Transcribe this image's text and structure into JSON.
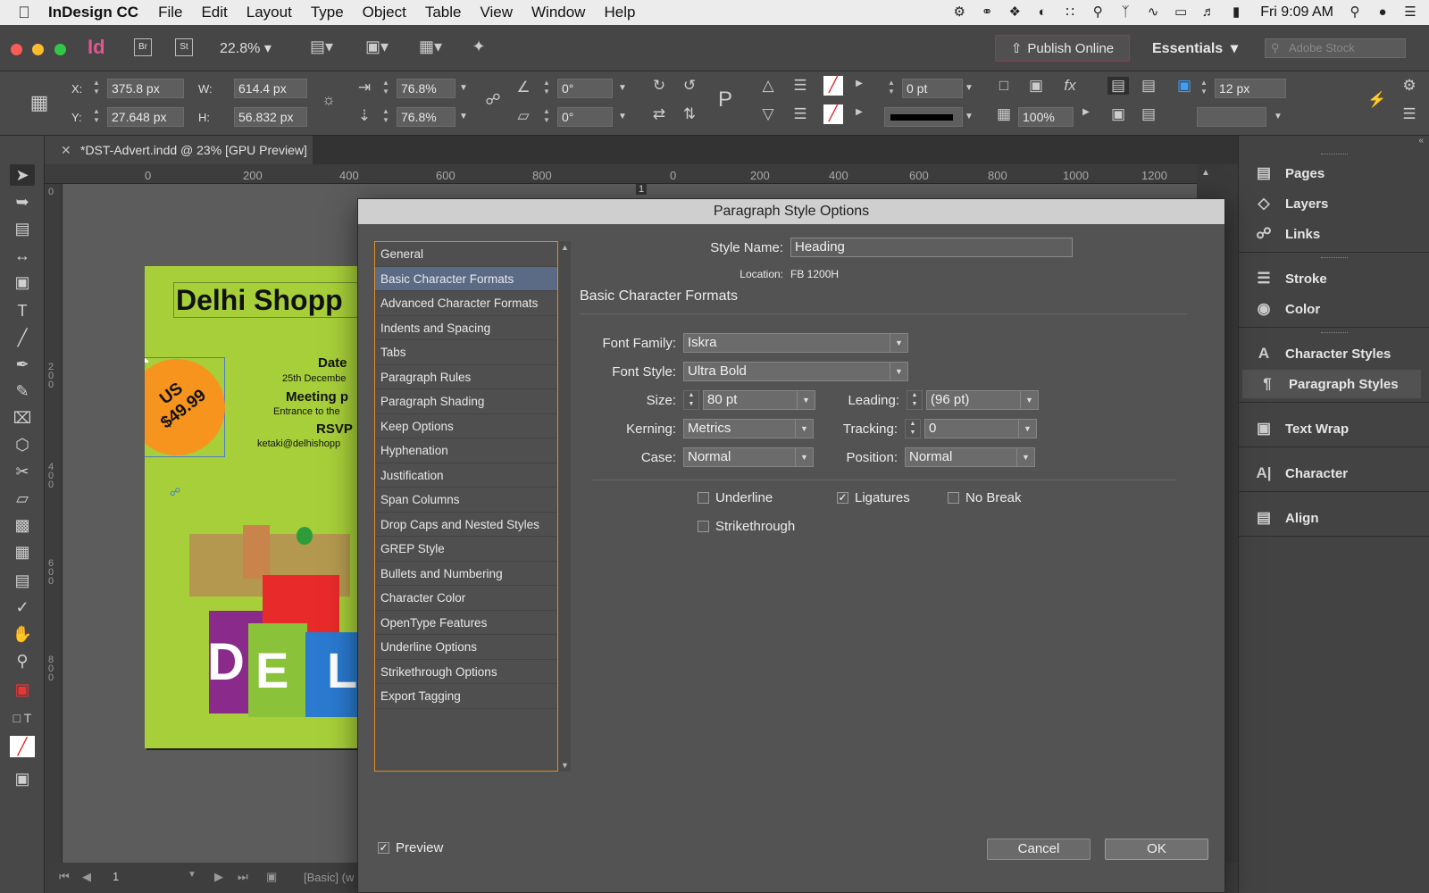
{
  "menubar": {
    "app_name": "InDesign CC",
    "items": [
      "File",
      "Edit",
      "Layout",
      "Type",
      "Object",
      "Table",
      "View",
      "Window",
      "Help"
    ],
    "clock": "Fri 9:09 AM"
  },
  "appbar": {
    "badges": [
      "Br",
      "St"
    ],
    "zoom": "22.8%",
    "publish_label": "Publish Online",
    "workspace": "Essentials",
    "stock_placeholder": "Adobe Stock"
  },
  "control": {
    "x_label": "X:",
    "x_value": "375.8 px",
    "y_label": "Y:",
    "y_value": "27.648 px",
    "w_label": "W:",
    "w_value": "614.4 px",
    "h_label": "H:",
    "h_value": "56.832 px",
    "scale_x": "76.8%",
    "scale_y": "76.8%",
    "rotate": "0°",
    "shear": "0°",
    "stroke_weight": "0 pt",
    "opacity": "100%",
    "spacing": "12 px"
  },
  "document": {
    "tab_title": "*DST-Advert.indd @ 23% [GPU Preview]",
    "ruler_left": [
      "0",
      "200",
      "400",
      "600",
      "800"
    ],
    "ruler_right": [
      "0",
      "200",
      "400",
      "600",
      "800",
      "1000",
      "1200"
    ],
    "ruler_page": "1",
    "flyer": {
      "title": "Delhi Shopp",
      "line1": "Date",
      "line2": "25th Decembe",
      "line3": "Meeting p",
      "line4": "Entrance to the",
      "line5": "RSVP",
      "line6": "ketaki@delhishopp",
      "price_line1": "US",
      "price_line2": "$49.99",
      "bag_letters": [
        "D",
        "E",
        "L"
      ]
    },
    "page_number": "1",
    "status_text": "[Basic] (w"
  },
  "panels": {
    "items": [
      "Pages",
      "Layers",
      "Links",
      "Stroke",
      "Color",
      "Character Styles",
      "Paragraph Styles",
      "Text Wrap",
      "Character",
      "Align"
    ]
  },
  "dialog": {
    "title": "Paragraph Style Options",
    "categories": [
      "General",
      "Basic Character Formats",
      "Advanced Character Formats",
      "Indents and Spacing",
      "Tabs",
      "Paragraph Rules",
      "Paragraph Shading",
      "Keep Options",
      "Hyphenation",
      "Justification",
      "Span Columns",
      "Drop Caps and Nested Styles",
      "GREP Style",
      "Bullets and Numbering",
      "Character Color",
      "OpenType Features",
      "Underline Options",
      "Strikethrough Options",
      "Export Tagging"
    ],
    "selected_category": "Basic Character Formats",
    "style_name_label": "Style Name:",
    "style_name_value": "Heading",
    "location_label": "Location:",
    "location_value": "FB 1200H",
    "section_title": "Basic Character Formats",
    "font_family_label": "Font Family:",
    "font_family_value": "Iskra",
    "font_style_label": "Font Style:",
    "font_style_value": "Ultra Bold",
    "size_label": "Size:",
    "size_value": "80 pt",
    "leading_label": "Leading:",
    "leading_value": "(96 pt)",
    "kerning_label": "Kerning:",
    "kerning_value": "Metrics",
    "tracking_label": "Tracking:",
    "tracking_value": "0",
    "case_label": "Case:",
    "case_value": "Normal",
    "position_label": "Position:",
    "position_value": "Normal",
    "underline_label": "Underline",
    "underline_checked": false,
    "ligatures_label": "Ligatures",
    "ligatures_checked": true,
    "nobreak_label": "No Break",
    "nobreak_checked": false,
    "strikethrough_label": "Strikethrough",
    "strikethrough_checked": false,
    "preview_label": "Preview",
    "preview_checked": true,
    "cancel_label": "Cancel",
    "ok_label": "OK"
  }
}
